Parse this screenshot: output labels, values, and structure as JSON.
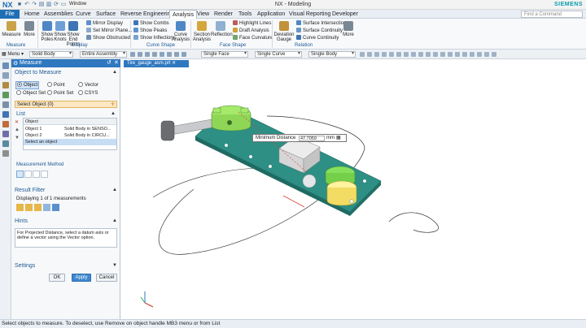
{
  "titlebar": {
    "logo": "NX",
    "window_menu": "Window",
    "title": "NX - Modeling",
    "brand": "SIEMENS"
  },
  "menubar": {
    "file": "File",
    "items": [
      "Home",
      "Assemblies",
      "Curve",
      "Surface",
      "Reverse Engineering",
      "Analysis",
      "View",
      "Render",
      "Tools",
      "Application",
      "Visual Reporting",
      "Developer"
    ],
    "active": "Analysis",
    "find_placeholder": "Find a Command"
  },
  "ribbon": {
    "measure": "Measure",
    "more": "More",
    "show_poles": "Show Poles",
    "show_knots": "Show Knots",
    "show_end_points": "Show End Points",
    "mirror_display": "Mirror Display",
    "set_mirror_plane": "Set Mirror Plane...",
    "show_obstructed": "Show Obstructed",
    "show_combs": "Show Combs",
    "show_peaks": "Show Peaks",
    "show_inflections": "Show Inflections",
    "curve_analysis": "Curve Analysis",
    "section_analysis": "Section Analysis",
    "reflection": "Reflection",
    "highlight_lines": "Highlight Lines",
    "draft_analysis": "Draft Analysis",
    "face_curvature": "Face Curvature",
    "deviation_gauge": "Deviation Gauge",
    "surface_intersection": "Surface Intersection",
    "surface_continuity": "Surface Continuity",
    "curve_continuity": "Curve Continuity",
    "more2": "More",
    "groups": [
      "Measure",
      "Display",
      "Curve Shape",
      "Face Shape",
      "Relation"
    ]
  },
  "filterbar": {
    "menu": "Menu",
    "filter1": "Solid Body",
    "filter2": "Entire Assembly",
    "filter3": "Single Face",
    "filter4": "Single Curve",
    "filter5": "Single Body"
  },
  "dialog": {
    "title": "Measure",
    "section_object": "Object to Measure",
    "radios": [
      "Object",
      "Point",
      "Vector",
      "Object Set",
      "Point Set",
      "CSYS"
    ],
    "select_object": "Select Object (0)",
    "list_label": "List",
    "list_header": "Object",
    "list_rows": [
      {
        "name": "Object 1",
        "desc": "Solid Body in SENSO..."
      },
      {
        "name": "Object 2",
        "desc": "Solid Body in CIRCU..."
      },
      {
        "name": "Select an object",
        "desc": ""
      }
    ],
    "measurement_method": "Measurement Method",
    "result_filter": "Result Filter",
    "result_text": "Displaying 1 of 1 measurements",
    "hints": "Hints",
    "hint_text": "For Projected Distance, select a datum axis or define a vector using the Vector option.",
    "settings": "Settings",
    "ok": "OK",
    "apply": "Apply",
    "cancel": "Cancel"
  },
  "viewport": {
    "tab": "Tire_gauge_asm.prt",
    "tooltip_label": "Minimum Distance",
    "tooltip_value": "47.7059",
    "tooltip_unit": "mm"
  },
  "statusbar": {
    "text": "Select objects to measure. To deselect, use Remove on object handle MB3 menu or from List"
  }
}
